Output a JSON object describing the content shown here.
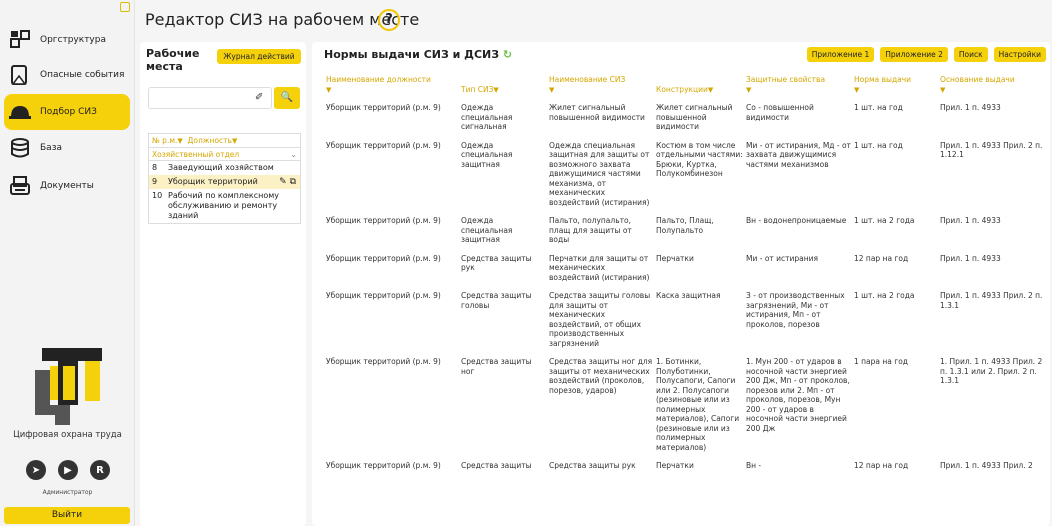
{
  "sidebar": {
    "items": [
      {
        "label": "Оргструктура",
        "icon": "org-structure-icon"
      },
      {
        "label": "Опасные события",
        "icon": "hazard-events-icon"
      },
      {
        "label": "Подбор СИЗ",
        "icon": "helmet-icon"
      },
      {
        "label": "База",
        "icon": "database-icon"
      },
      {
        "label": "Документы",
        "icon": "documents-icon"
      }
    ],
    "logo_caption": "Цифровая охрана труда",
    "socials": [
      {
        "icon": "telegram-icon",
        "glyph": "➤"
      },
      {
        "icon": "youtube-icon",
        "glyph": "▶"
      },
      {
        "icon": "rutube-icon",
        "glyph": "R"
      }
    ],
    "user": "Администратор",
    "logout_label": "Выйти"
  },
  "page": {
    "title": "Редактор СИЗ на рабочем месте",
    "help": "?"
  },
  "workplaces": {
    "title": "Рабочие места",
    "journal_button": "Журнал действий",
    "search_placeholder": "",
    "clear_glyph": "✐",
    "search_glyph": "🔍",
    "col_num": "№ р.м.",
    "col_position": "Должность",
    "department": "Хозяйственный отдел",
    "rows": [
      {
        "num": "8",
        "name": "Заведующий хозяйством"
      },
      {
        "num": "9",
        "name": "Уборщик территорий"
      },
      {
        "num": "10",
        "name": "Рабочий по комплексному обслуживанию и ремонту зданий"
      }
    ],
    "edit_glyph": "✎",
    "copy_glyph": "⧉"
  },
  "norms": {
    "title": "Нормы выдачи СИЗ и ДСИЗ",
    "refresh_glyph": "↻",
    "buttons": [
      "Приложение 1",
      "Приложение 2",
      "Поиск",
      "Настройки"
    ],
    "columns": [
      "Наименование должности",
      "Тип СИЗ",
      "Наименование СИЗ",
      "Конструкции",
      "Защитные свойства",
      "Норма выдачи",
      "Основание выдачи"
    ],
    "filter_glyph": "▼",
    "rows": [
      [
        "Уборщик территорий (р.м. 9)",
        "Одежда специальная сигнальная",
        "Жилет сигнальный повышенной видимости",
        "Жилет сигнальный повышенной видимости",
        "Со - повышенной видимости",
        "1 шт. на год",
        "Прил. 1 п. 4933"
      ],
      [
        "Уборщик территорий (р.м. 9)",
        "Одежда специальная защитная",
        "Одежда специальная защитная для защиты от возможного захвата движущимися частями механизма, от механических воздействий (истирания)",
        "Костюм в том числе отдельными частями: Брюки, Куртка, Полукомбинезон",
        "Ми - от истирания, Мд - от захвата движущимися частями механизмов",
        "1 шт. на год",
        "Прил. 1 п. 4933 Прил. 2 п. 1.12.1"
      ],
      [
        "Уборщик территорий (р.м. 9)",
        "Одежда специальная защитная",
        "Пальто, полупальто, плащ для защиты от воды",
        "Пальто, Плащ, Полупальто",
        "Вн - водонепроницаемые",
        "1 шт. на 2 года",
        "Прил. 1 п. 4933"
      ],
      [
        "Уборщик территорий (р.м. 9)",
        "Средства защиты рук",
        "Перчатки для защиты от механических воздействий (истирания)",
        "Перчатки",
        "Ми - от истирания",
        "12 пар на год",
        "Прил. 1 п. 4933"
      ],
      [
        "Уборщик территорий (р.м. 9)",
        "Средства защиты головы",
        "Средства защиты головы для защиты от механических воздействий, от общих производственных загрязнений",
        "Каска защитная",
        "З - от производственных загрязнений, Ми - от истирания, Мп - от проколов, порезов",
        "1 шт. на 2 года",
        "Прил. 1 п. 4933 Прил. 2 п. 1.3.1"
      ],
      [
        "Уборщик территорий (р.м. 9)",
        "Средства защиты ног",
        "Средства защиты ног для защиты от механических воздействий (проколов, порезов, ударов)",
        "1. Ботинки, Полуботинки, Полусапоги, Сапоги или 2. Полусапоги (резиновые или из полимерных материалов), Сапоги (резиновые или из полимерных материалов)",
        "1. Мун 200 - от ударов в носочной части энергией 200 Дж, Мп - от проколов, порезов или 2. Мп - от проколов, порезов, Мун 200 - от ударов в носочной части энергией 200 Дж",
        "1 пара на год",
        "1. Прил. 1 п. 4933 Прил. 2 п. 1.3.1 или 2. Прил. 2 п. 1.3.1"
      ],
      [
        "Уборщик территорий (р.м. 9)",
        "Средства защиты",
        "Средства защиты рук",
        "Перчатки",
        "Вн -",
        "12 пар на год",
        "Прил. 1 п. 4933 Прил. 2"
      ]
    ]
  }
}
